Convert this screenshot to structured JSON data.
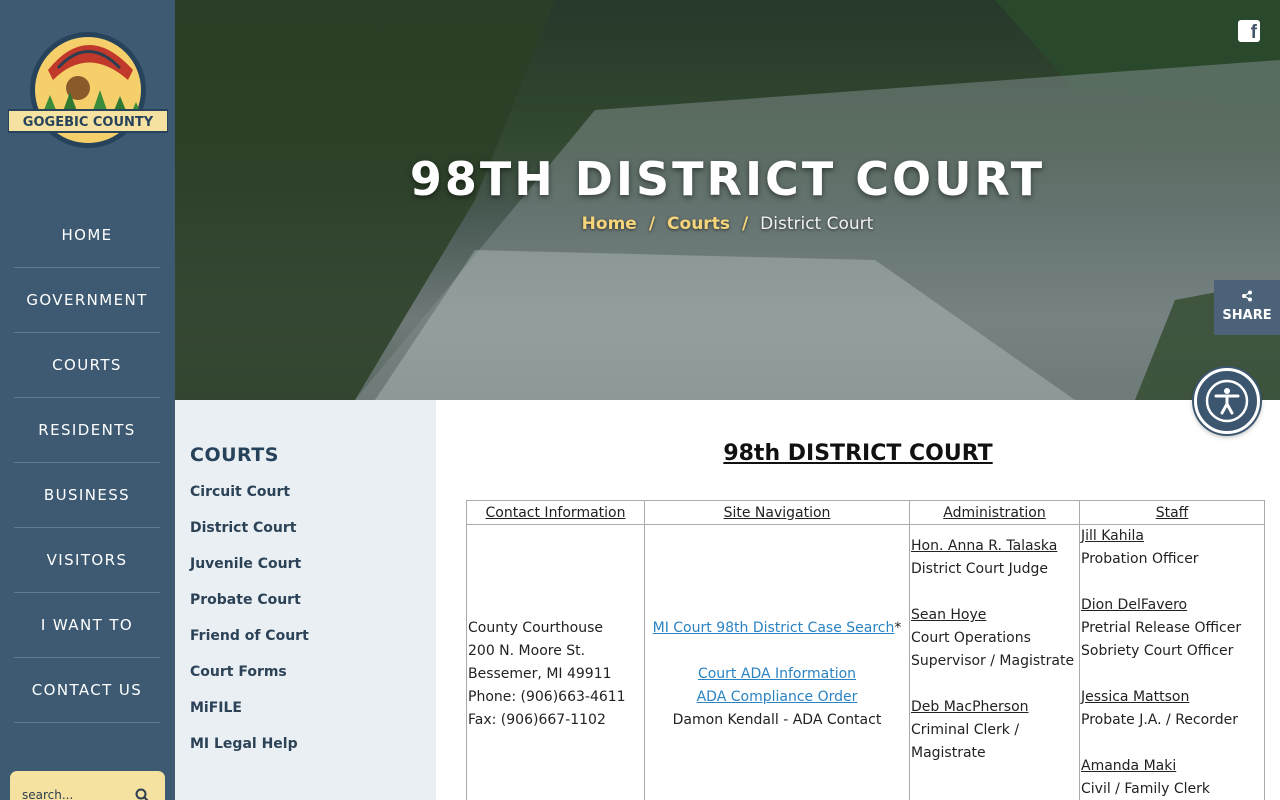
{
  "logo": {
    "text": "GOGEBIC COUNTY"
  },
  "nav": {
    "items": [
      "HOME",
      "GOVERNMENT",
      "COURTS",
      "RESIDENTS",
      "BUSINESS",
      "VISITORS",
      "I WANT TO",
      "CONTACT US"
    ]
  },
  "search": {
    "placeholder": "search..."
  },
  "hero": {
    "title": "98TH DISTRICT COURT",
    "breadcrumb": {
      "home": "Home",
      "sep1": "/",
      "courts": "Courts",
      "sep2": "/",
      "current": "District Court"
    }
  },
  "social": {
    "facebook": "f"
  },
  "share": {
    "label": "SHARE"
  },
  "subnav": {
    "title": "COURTS",
    "items": [
      "Circuit Court",
      "District Court",
      "Juvenile Court",
      "Probate Court",
      "Friend of Court",
      "Court Forms",
      "MiFILE",
      "MI Legal Help"
    ]
  },
  "content": {
    "title": "98th DISTRICT COURT",
    "table": {
      "headers": [
        "Contact Information",
        "Site Navigation",
        "Administration",
        "Staff"
      ],
      "contact": [
        "County Courthouse",
        "200 N. Moore St.",
        "Bessemer, MI 49911",
        "Phone: (906)663-4611",
        "Fax: (906)667-1102"
      ],
      "navigation": {
        "case_search": "MI Court 98th District Case Search",
        "asterisk": "*",
        "ada_info": "Court ADA Information",
        "ada_order": "ADA Compliance Order",
        "ada_contact": "Damon Kendall - ADA Contact"
      },
      "administration": [
        {
          "name": "Hon. Anna R. Talaska",
          "role": "District Court Judge"
        },
        {
          "name": "Sean Hoye",
          "role": "Court Operations Supervisor / Magistrate"
        },
        {
          "name": "Deb MacPherson",
          "role": "Criminal Clerk / Magistrate"
        }
      ],
      "staff": [
        {
          "name": "Jill Kahila",
          "role": "Probation Officer"
        },
        {
          "name": "Dion DelFavero",
          "role": "Pretrial Release Officer",
          "role2": "Sobriety Court Officer"
        },
        {
          "name": "Jessica Mattson",
          "role": "Probate J.A. / Recorder"
        },
        {
          "name": "Amanda Maki",
          "role": "Civil / Family Clerk"
        }
      ]
    }
  },
  "colors": {
    "sidebar": "#3d5a72",
    "accent": "#f6d47a",
    "link": "#2b83c2",
    "subnav_bg": "#eaeff3"
  }
}
